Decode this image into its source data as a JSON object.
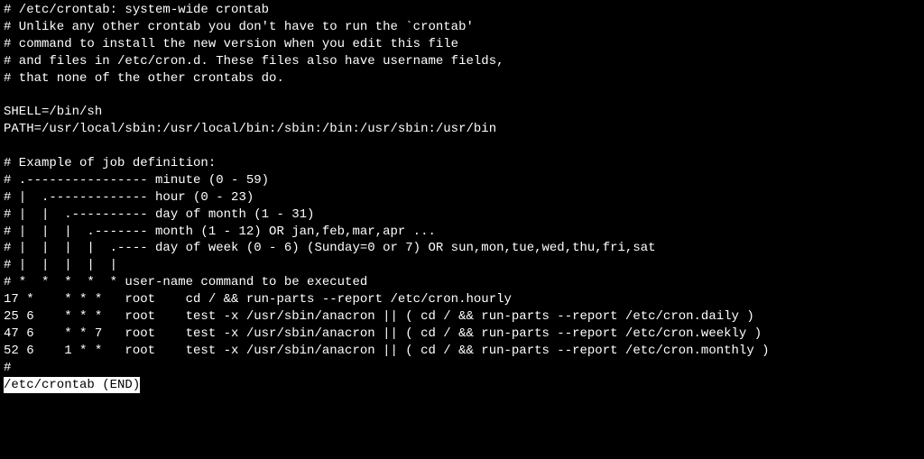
{
  "lines": [
    "# /etc/crontab: system-wide crontab",
    "# Unlike any other crontab you don't have to run the `crontab'",
    "# command to install the new version when you edit this file",
    "# and files in /etc/cron.d. These files also have username fields,",
    "# that none of the other crontabs do.",
    "",
    "SHELL=/bin/sh",
    "PATH=/usr/local/sbin:/usr/local/bin:/sbin:/bin:/usr/sbin:/usr/bin",
    "",
    "# Example of job definition:",
    "# .---------------- minute (0 - 59)",
    "# |  .------------- hour (0 - 23)",
    "# |  |  .---------- day of month (1 - 31)",
    "# |  |  |  .------- month (1 - 12) OR jan,feb,mar,apr ...",
    "# |  |  |  |  .---- day of week (0 - 6) (Sunday=0 or 7) OR sun,mon,tue,wed,thu,fri,sat",
    "# |  |  |  |  |",
    "# *  *  *  *  * user-name command to be executed",
    "17 *    * * *   root    cd / && run-parts --report /etc/cron.hourly",
    "25 6    * * *   root    test -x /usr/sbin/anacron || ( cd / && run-parts --report /etc/cron.daily )",
    "47 6    * * 7   root    test -x /usr/sbin/anacron || ( cd / && run-parts --report /etc/cron.weekly )",
    "52 6    1 * *   root    test -x /usr/sbin/anacron || ( cd / && run-parts --report /etc/cron.monthly )",
    "#"
  ],
  "status": "/etc/crontab (END)"
}
